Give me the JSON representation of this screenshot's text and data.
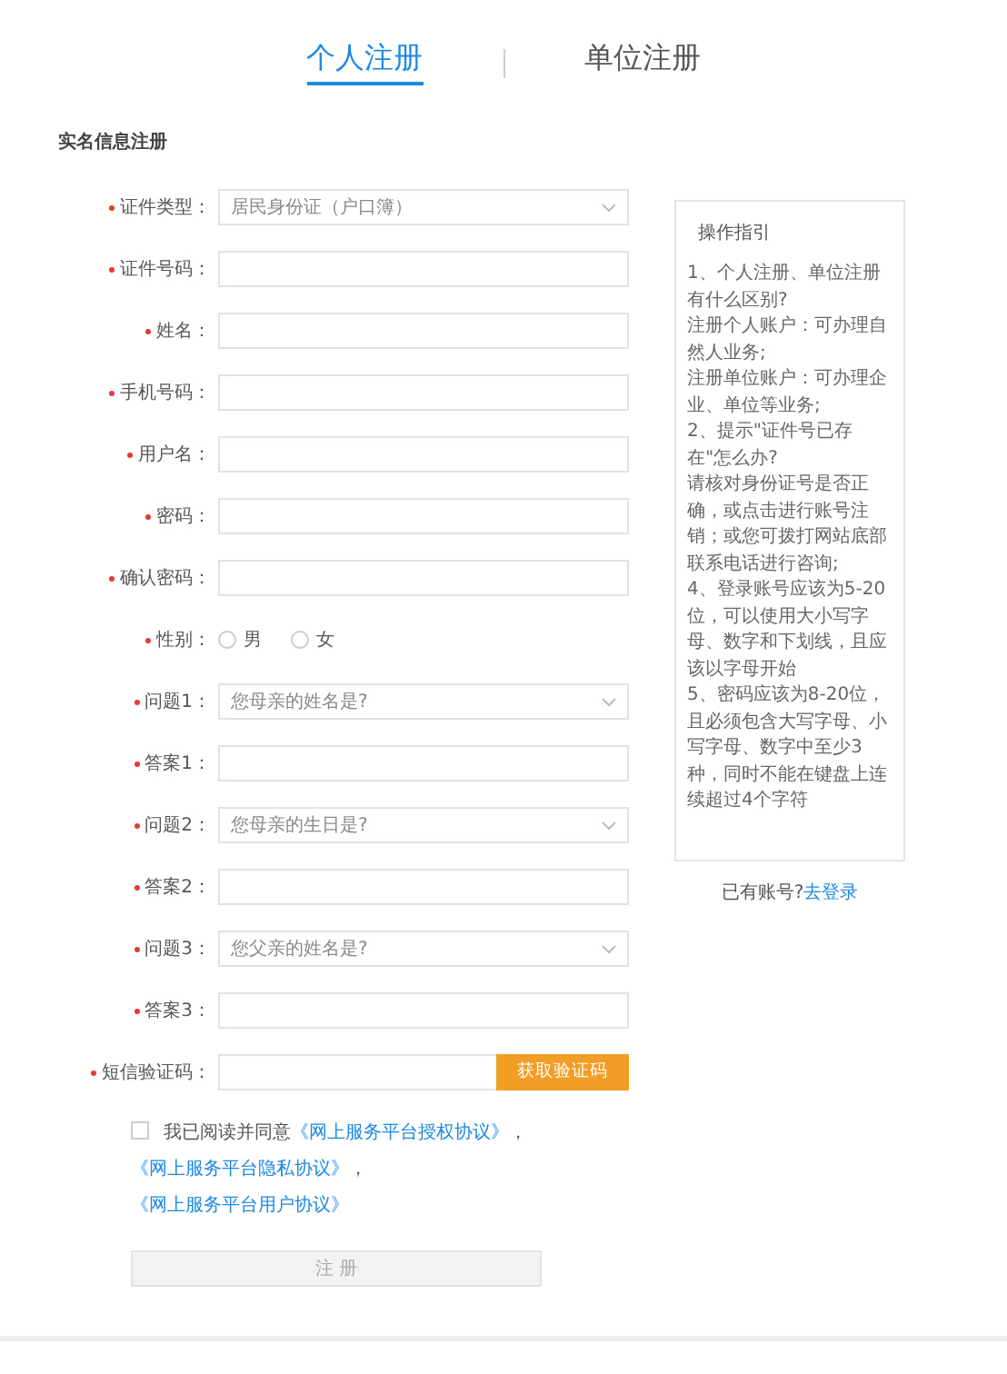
{
  "tabs": [
    {
      "label": "个人注册",
      "selected": true
    },
    {
      "label": "单位注册",
      "selected": false
    }
  ],
  "section_title": "实名信息注册",
  "fields": [
    {
      "kind": "select",
      "label": "证件类型：",
      "required": true,
      "value": "居民身份证（户口簿）"
    },
    {
      "kind": "input",
      "label": "证件号码：",
      "required": true
    },
    {
      "kind": "input",
      "label": "姓名：",
      "required": true
    },
    {
      "kind": "input",
      "label": "手机号码：",
      "required": true
    },
    {
      "kind": "input",
      "label": "用户名：",
      "required": true
    },
    {
      "kind": "input",
      "label": "密码：",
      "required": true
    },
    {
      "kind": "input",
      "label": "确认密码：",
      "required": true
    },
    {
      "kind": "radio",
      "label": "性别：",
      "required": true,
      "options": [
        {
          "label": "男",
          "selected": false
        },
        {
          "label": "女",
          "selected": false
        }
      ]
    },
    {
      "kind": "select",
      "label": "问题1：",
      "required": true,
      "value": "您母亲的姓名是?"
    },
    {
      "kind": "input",
      "label": "答案1：",
      "required": true
    },
    {
      "kind": "select",
      "label": "问题2：",
      "required": true,
      "value": "您母亲的生日是?"
    },
    {
      "kind": "input",
      "label": "答案2：",
      "required": true
    },
    {
      "kind": "select",
      "label": "问题3：",
      "required": true,
      "value": "您父亲的姓名是?"
    },
    {
      "kind": "input",
      "label": "答案3：",
      "required": true
    },
    {
      "kind": "sms",
      "label": "短信验证码：",
      "required": true,
      "button": "获取验证码"
    }
  ],
  "agreement": {
    "checked": false,
    "parts": [
      {
        "kind": "text",
        "text": "我已阅读并同意"
      },
      {
        "kind": "link",
        "text": "《网上服务平台授权协议》"
      },
      {
        "kind": "text",
        "text": "，"
      },
      {
        "kind": "link",
        "text": "《网上服务平台隐私协议》"
      },
      {
        "kind": "text",
        "text": "，"
      },
      {
        "kind": "link",
        "text": "《网上服务平台用户协议》"
      }
    ]
  },
  "submit": {
    "label": "注 册",
    "disabled": true
  },
  "guide": {
    "title": "操作指引",
    "lines": [
      "1、个人注册、单位注册有什么区别?",
      "注册个人账户：可办理自然人业务;",
      "注册单位账户：可办理企业、单位等业务;",
      "2、提示\"证件号已存在\"怎么办?",
      "请核对身份证号是否正确，或点击进行账号注销；或您可拨打网站底部联系电话进行咨询;",
      "4、登录账号应该为5-20位，可以使用大小写字母、数字和下划线，且应该以字母开始",
      "5、密码应该为8-20位，且必须包含大写字母、小写字母、数字中至少3种，同时不能在键盘上连续超过4个字符"
    ]
  },
  "login": {
    "prompt": "已有账号?",
    "link": "去登录"
  }
}
